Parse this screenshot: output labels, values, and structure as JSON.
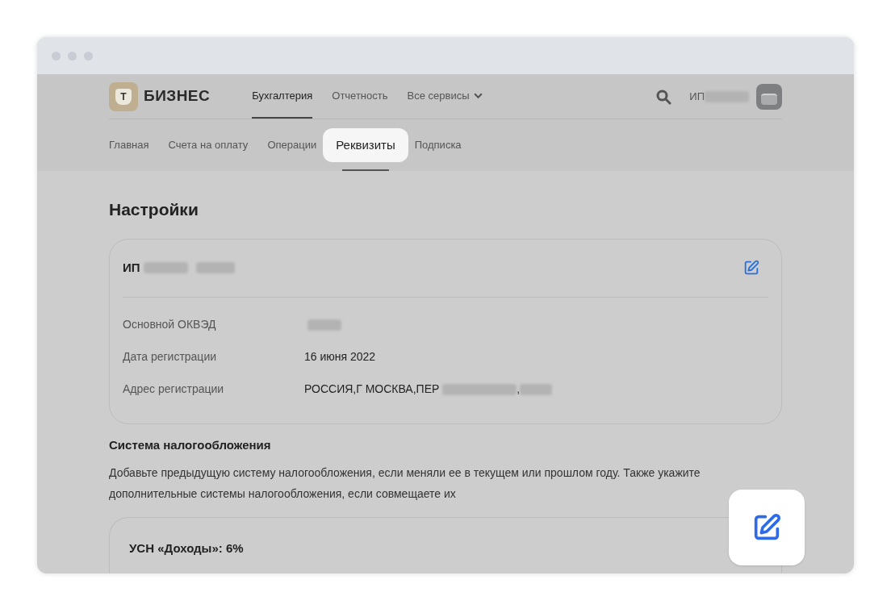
{
  "brand": {
    "logo_letter": "Т",
    "name": "БИЗНЕС"
  },
  "top_nav": [
    {
      "label": "Бухгалтерия",
      "selected": true,
      "dropdown": false
    },
    {
      "label": "Отчетность",
      "selected": false,
      "dropdown": false
    },
    {
      "label": "Все сервисы",
      "selected": false,
      "dropdown": true
    }
  ],
  "account": {
    "label": "ИП",
    "redacted": true
  },
  "sub_nav": [
    {
      "label": "Главная",
      "selected": false
    },
    {
      "label": "Счета на оплату",
      "selected": false
    },
    {
      "label": "Операции",
      "selected": false
    },
    {
      "label": "Реквизиты",
      "selected": true
    },
    {
      "label": "Подписка",
      "selected": false
    }
  ],
  "page_title": "Настройки",
  "company_card": {
    "name": "ИП",
    "redacted": true,
    "fields": [
      {
        "label": "Основной ОКВЭД",
        "redacted": true
      },
      {
        "label": "Дата регистрации",
        "value": "16 июня 2022",
        "redacted": false
      },
      {
        "label": "Адрес регистрации",
        "value": "РОССИЯ,Г МОСКВА,ПЕР",
        "redacted": true,
        "separator": ","
      }
    ]
  },
  "tax_section": {
    "title": "Система налогообложения",
    "description": "Добавьте предыдущую систему налогообложения, если меняли ее в текущем или прошлом году. Также укажите дополнительные системы налогообложения, если совмещаете их",
    "systems": [
      {
        "name": "УСН «Доходы»: 6%"
      }
    ]
  }
}
